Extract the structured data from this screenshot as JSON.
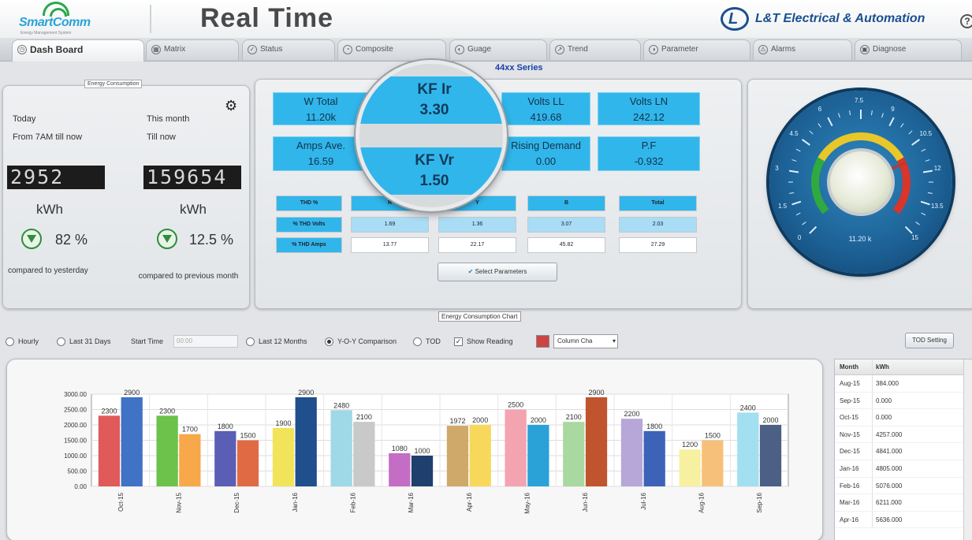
{
  "header": {
    "logo_text": "SmartComm",
    "logo_tagline": "Energy Management System",
    "title": "Real Time",
    "brand": "L&T Electrical & Automation",
    "help_label": "?"
  },
  "tabs": [
    {
      "label": "Dash Board",
      "icon": "dashboard-icon",
      "active": true
    },
    {
      "label": "Matrix",
      "icon": "matrix-icon"
    },
    {
      "label": "Status",
      "icon": "status-icon"
    },
    {
      "label": "Composite",
      "icon": "composite-icon"
    },
    {
      "label": "Guage",
      "icon": "gauge-icon"
    },
    {
      "label": "Trend",
      "icon": "trend-icon"
    },
    {
      "label": "Parameter",
      "icon": "parameter-icon"
    },
    {
      "label": "Alarms",
      "icon": "alarm-icon"
    },
    {
      "label": "Diagnose",
      "icon": "diagnose-icon"
    }
  ],
  "energy": {
    "legend": "Energy Consumption",
    "today_label": "Today",
    "today_sub": "From 7AM till now",
    "month_label": "This month",
    "month_sub": "Till now",
    "today_value": "2952",
    "month_value": "159654",
    "unit": "kWh",
    "today_pct": "82 %",
    "month_pct": "12.5 %",
    "today_compare": "compared to yesterday",
    "month_compare": "compared to previous month"
  },
  "params": {
    "series": "44xx Series",
    "boxes": [
      {
        "label": "W Total",
        "value": "11.20k"
      },
      {
        "label": "Volts LL",
        "value": "419.68"
      },
      {
        "label": "Volts LN",
        "value": "242.12"
      },
      {
        "label": "Amps Ave.",
        "value": "16.59"
      },
      {
        "label": "Rising Demand",
        "value": "0.00"
      },
      {
        "label": "P.F",
        "value": "-0.932"
      }
    ],
    "magnifier": [
      {
        "label": "KF Ir",
        "value": "3.30"
      },
      {
        "label": "KF Vr",
        "value": "1.50"
      }
    ],
    "thd_headers": [
      "THD %",
      "R",
      "Y",
      "B",
      "Total"
    ],
    "thd_volts": [
      "% THD Volts",
      "1.69",
      "1.36",
      "3.07",
      "2.03"
    ],
    "thd_amps": [
      "% THD Amps",
      "13.77",
      "22.17",
      "45.82",
      "27.29"
    ],
    "select_button": "Select Parameters"
  },
  "gauge": {
    "reading": "11.20 k",
    "ticks": [
      "0",
      "1.5",
      "3",
      "4.5",
      "6",
      "7.5",
      "9",
      "10.5",
      "12",
      "13.5",
      "15"
    ],
    "value": 11.2,
    "max": 15
  },
  "controls": {
    "chart_legend": "Energy Consumption Chart",
    "hourly": "Hourly",
    "last31": "Last 31 Days",
    "start_time_label": "Start Time",
    "start_time_value": "00:00",
    "last12": "Last 12 Months",
    "yoy": "Y-O-Y Comparison",
    "tod": "TOD",
    "show_reading": "Show Reading",
    "chart_type": "Column Cha",
    "tod_setting": "TOD Setting"
  },
  "chart_data": {
    "type": "bar",
    "categories": [
      "Oct-15",
      "Nov-15",
      "Dec-15",
      "Jan-16",
      "Feb-16",
      "Mar-16",
      "Apr-16",
      "May-16",
      "Jun-16",
      "Jul-16",
      "Aug-16",
      "Sep-16"
    ],
    "series": [
      {
        "values": [
          2300,
          2300,
          1800,
          1900,
          2480,
          1080,
          1972,
          2500,
          2100,
          2200,
          1200,
          2400
        ]
      },
      {
        "values": [
          2900,
          1700,
          1500,
          2900,
          2100,
          1000,
          2000,
          2000,
          2900,
          1800,
          1500,
          2000
        ]
      }
    ],
    "colors_a": [
      "#e15a5a",
      "#6cc24a",
      "#5a5fb5",
      "#f1e35a",
      "#9fd8e6",
      "#c36ec4",
      "#cfa96a",
      "#f4a3b0",
      "#a9d8a0",
      "#b7a7d8",
      "#f7f0a0",
      "#a2dff0"
    ],
    "colors_b": [
      "#4072c5",
      "#f7a84a",
      "#e06a44",
      "#1f4f8c",
      "#c9c9c9",
      "#1f3f6e",
      "#f7d85a",
      "#2aa2d8",
      "#c0542e",
      "#3c63b8",
      "#f7c07a",
      "#4c5f85"
    ],
    "y_ticks": [
      "0.00",
      "500.00",
      "1000.00",
      "1500.00",
      "2000.00",
      "2500.00",
      "3000.00"
    ],
    "ylim": [
      0,
      3000
    ],
    "grid": true,
    "show_labels": true
  },
  "table": {
    "headers": [
      "Month",
      "kWh"
    ],
    "rows": [
      [
        "Aug-15",
        "384.000"
      ],
      [
        "Sep-15",
        "0.000"
      ],
      [
        "Oct-15",
        "0.000"
      ],
      [
        "Nov-15",
        "4257.000"
      ],
      [
        "Dec-15",
        "4841.000"
      ],
      [
        "Jan-16",
        "4805.000"
      ],
      [
        "Feb-16",
        "5076.000"
      ],
      [
        "Mar-16",
        "6211.000"
      ],
      [
        "Apr-16",
        "5636.000"
      ]
    ]
  }
}
